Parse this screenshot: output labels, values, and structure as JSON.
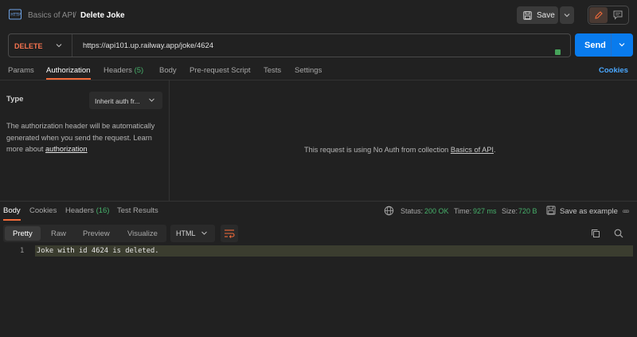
{
  "header": {
    "breadcrumb_parent": "Basics of API",
    "breadcrumb_sep": "/",
    "breadcrumb_current": "Delete Joke",
    "save_label": "Save"
  },
  "request": {
    "method": "DELETE",
    "url": "https://api101.up.railway.app/joke/4624",
    "send_label": "Send"
  },
  "request_tabs": {
    "params": "Params",
    "authorization": "Authorization",
    "headers_label": "Headers",
    "headers_count": "(5)",
    "body": "Body",
    "pre_request": "Pre-request Script",
    "tests": "Tests",
    "settings": "Settings",
    "cookies": "Cookies"
  },
  "auth": {
    "type_label": "Type",
    "type_value": "Inherit auth fr...",
    "description": "The authorization header will be automatically generated when you send the request. Learn more about ",
    "link_text": "authorization",
    "no_auth_message": "This request is using No Auth from collection ",
    "collection_link": "Basics of API",
    "period": "."
  },
  "response_tabs": {
    "body": "Body",
    "cookies": "Cookies",
    "headers_label": "Headers",
    "headers_count": "(16)",
    "test_results": "Test Results"
  },
  "response_meta": {
    "status_label": "Status:",
    "status_value": "200 OK",
    "time_label": "Time:",
    "time_value": "927 ms",
    "size_label": "Size:",
    "size_value": "720 B",
    "save_example": "Save as example",
    "more": "ooo"
  },
  "format": {
    "pretty": "Pretty",
    "raw": "Raw",
    "preview": "Preview",
    "visualize": "Visualize",
    "language": "HTML"
  },
  "response_body": {
    "line_number": "1",
    "line_text": "Joke with id 4624 is deleted."
  },
  "colors": {
    "accent": "#f26b3a",
    "send": "#097bed",
    "method": "#f5734f",
    "success": "#46b06a",
    "link": "#4aa8ff"
  }
}
